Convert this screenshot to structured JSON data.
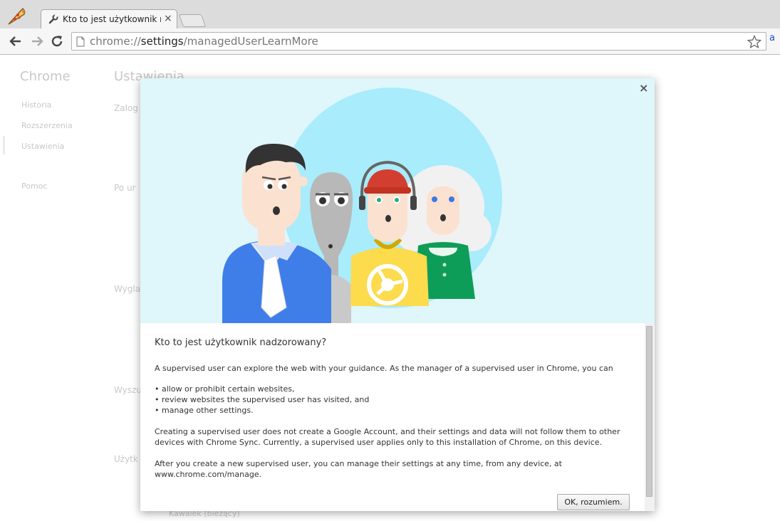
{
  "tab": {
    "title": "Kto to jest użytkownik nadzorowany?",
    "close": "×"
  },
  "omnibox": {
    "scheme": "chrome://",
    "host": "settings",
    "path": "/managedUserLearnMore"
  },
  "extension": {
    "label": "a"
  },
  "settings_bg": {
    "brand": "Chrome",
    "heading": "Ustawienia",
    "nav": [
      "Historia",
      "Rozszerzenia",
      "Ustawienia",
      "Pomoc"
    ],
    "sections": [
      "Zalog",
      "Po ur",
      "Wygla",
      "Wyszu",
      "Użytk"
    ],
    "user_item": "Kawaiek (bieżący)"
  },
  "dialog": {
    "close": "×",
    "title": "Kto to jest użytkownik nadzorowany?",
    "intro": "A supervised user can explore the web with your guidance. As the manager of a supervised user in Chrome, you can",
    "bullets": [
      "• allow or prohibit certain websites,",
      "• review websites the supervised user has visited, and",
      "• manage other settings."
    ],
    "sync_paragraph": "Creating a supervised user does not create a Google Account, and their settings and data will not follow them to other devices with Chrome Sync. Currently, a supervised user applies only to this installation of Chrome, on this device.",
    "manage_paragraph": "After you create a new supervised user, you can manage their settings at any time, from any device, at www.chrome.com/manage.",
    "ok_label": "OK, rozumiem."
  },
  "colors": {
    "illustration_bg": "#dff6fb",
    "circle": "#a9ecfb",
    "shirt_blue": "#3f7ee8",
    "shirt_yellow": "#fcdb4c",
    "shirt_green": "#0e9d58",
    "hat_red": "#d23f31"
  }
}
